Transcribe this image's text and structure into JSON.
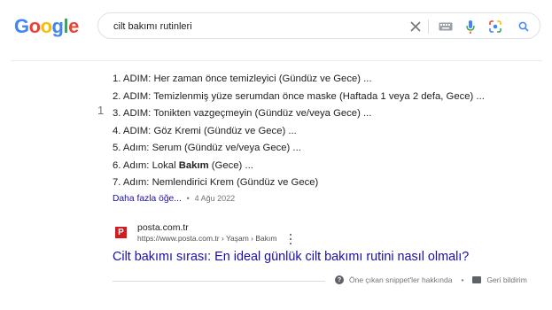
{
  "logo": {
    "letters": [
      "G",
      "o",
      "o",
      "g",
      "l",
      "e"
    ],
    "colors": [
      "#4285F4",
      "#EA4335",
      "#FBBC05",
      "#4285F4",
      "#34A853",
      "#EA4335"
    ]
  },
  "search": {
    "query": "cilt bakımı rutinleri",
    "icons": [
      "clear-icon",
      "keyboard-icon",
      "mic-icon",
      "lens-icon",
      "search-icon"
    ]
  },
  "snippet": {
    "side_number": "1",
    "steps": [
      {
        "prefix": "1. ADIM: Her zaman önce temizleyici (Gündüz ve Gece) ...",
        "bold": "",
        "suffix": ""
      },
      {
        "prefix": "2. ADIM: Temizlenmiş yüze serumdan önce maske (Haftada 1 veya 2 defa, Gece) ...",
        "bold": "",
        "suffix": ""
      },
      {
        "prefix": "3. ADIM: Tonikten vazgeçmeyin (Gündüz ve/veya Gece) ...",
        "bold": "",
        "suffix": ""
      },
      {
        "prefix": "4. ADIM: Göz Kremi (Gündüz ve Gece) ...",
        "bold": "",
        "suffix": ""
      },
      {
        "prefix": "5. Adım: Serum (Gündüz ve/veya Gece) ...",
        "bold": "",
        "suffix": ""
      },
      {
        "prefix": "6. Adım: Lokal ",
        "bold": "Bakım",
        "suffix": " (Gece) ..."
      },
      {
        "prefix": "7. Adım: Nemlendirici Krem (Gündüz ve Gece)",
        "bold": "",
        "suffix": ""
      }
    ],
    "more_link": "Daha fazla öğe...",
    "separator": "•",
    "date": "4 Ağu 2022"
  },
  "result": {
    "favicon_letter": "P",
    "favicon_color": "#d71920",
    "site_name": "posta.com.tr",
    "url": "https://www.posta.com.tr › Yaşam › Bakım",
    "title": "Cilt bakımı sırası: En ideal günlük cilt bakımı rutini nasıl olmalı?"
  },
  "footer": {
    "about_label": "Öne çıkan snippet'ler hakkında",
    "separator": "•",
    "feedback_label": "Geri bildirim"
  }
}
